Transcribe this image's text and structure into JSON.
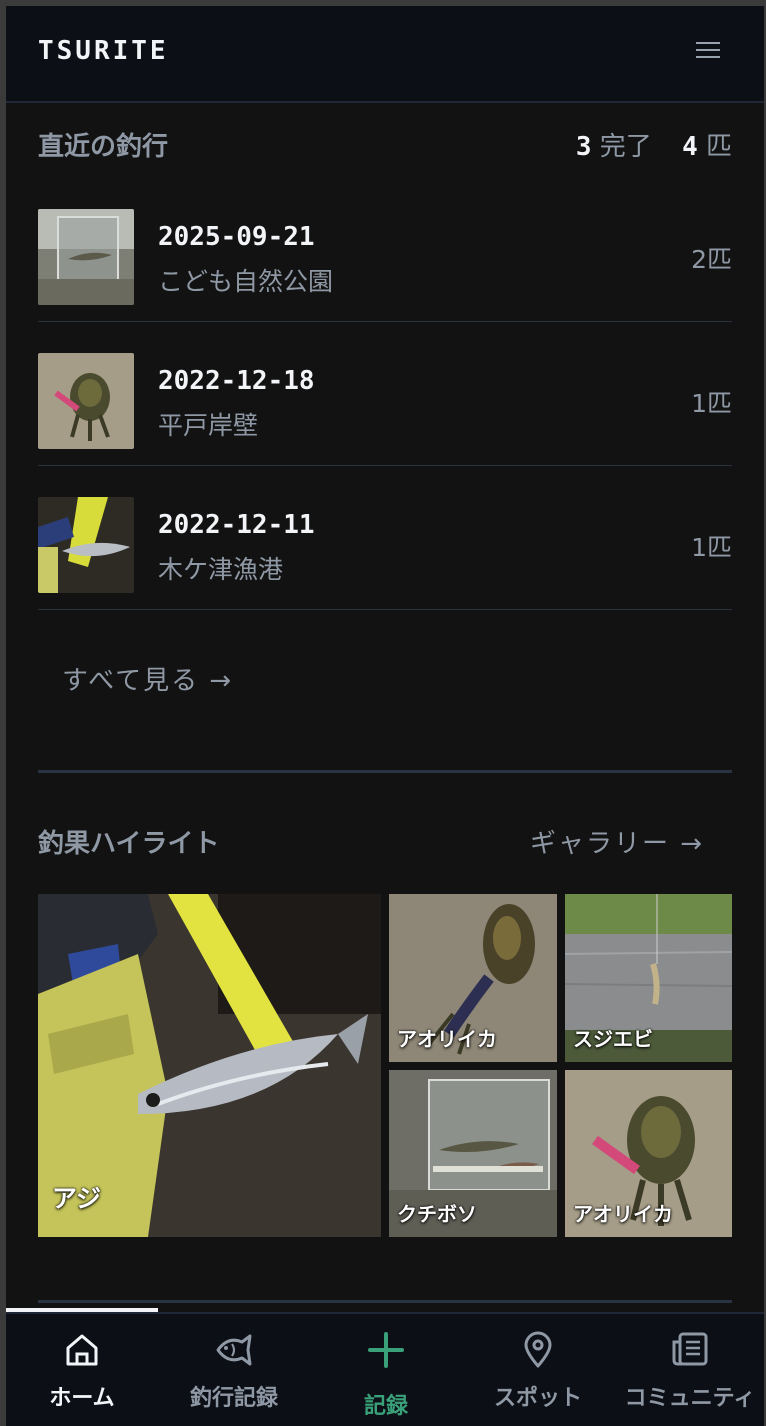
{
  "header": {
    "logo": "TSURITE"
  },
  "recent": {
    "title": "直近の釣行",
    "trip_count": "3",
    "trip_count_unit": "完了",
    "fish_count": "4",
    "fish_count_unit": "匹",
    "trips": [
      {
        "date": "2025-09-21",
        "place": "こども自然公園",
        "count": "2匹"
      },
      {
        "date": "2022-12-18",
        "place": "平戸岸壁",
        "count": "1匹"
      },
      {
        "date": "2022-12-11",
        "place": "木ケ津漁港",
        "count": "1匹"
      }
    ],
    "see_all": "すべて見る →"
  },
  "highlights": {
    "title": "釣果ハイライト",
    "gallery_link": "ギャラリー →",
    "tiles": [
      {
        "caption": "アジ"
      },
      {
        "caption": "アオリイカ"
      },
      {
        "caption": "スジエビ"
      },
      {
        "caption": "クチボソ"
      },
      {
        "caption": "アオリイカ"
      }
    ]
  },
  "tabs": [
    {
      "label": "ホーム",
      "icon": "home-icon"
    },
    {
      "label": "釣行記録",
      "icon": "fish-icon"
    },
    {
      "label": "記録",
      "icon": "plus-icon"
    },
    {
      "label": "スポット",
      "icon": "map-pin-icon"
    },
    {
      "label": "コミュニティ",
      "icon": "newspaper-icon"
    }
  ],
  "colors": {
    "background": "#121212",
    "header": "#0c0f15",
    "accent": "#3aa07a",
    "muted_text": "#8f98a5"
  }
}
